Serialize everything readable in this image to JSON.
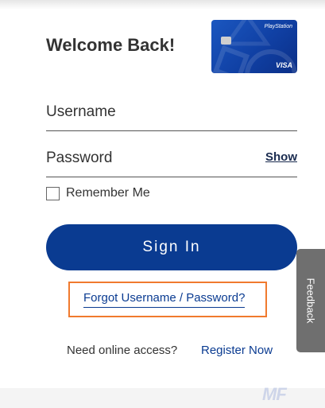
{
  "header": {
    "title": "Welcome Back!"
  },
  "card": {
    "brand": "PlayStation",
    "network": "VISA"
  },
  "form": {
    "username_label": "Username",
    "password_label": "Password",
    "show_label": "Show",
    "remember_label": "Remember Me",
    "signin_label": "Sign In",
    "forgot_label": "Forgot Username / Password?",
    "access_text": "Need online access?",
    "register_label": "Register Now"
  },
  "feedback": {
    "label": "Feedback"
  },
  "watermark": {
    "text": "MF"
  },
  "colors": {
    "primary": "#0a3b91",
    "highlight": "#f07a2e",
    "feedback_tab": "#6f6f6f"
  }
}
